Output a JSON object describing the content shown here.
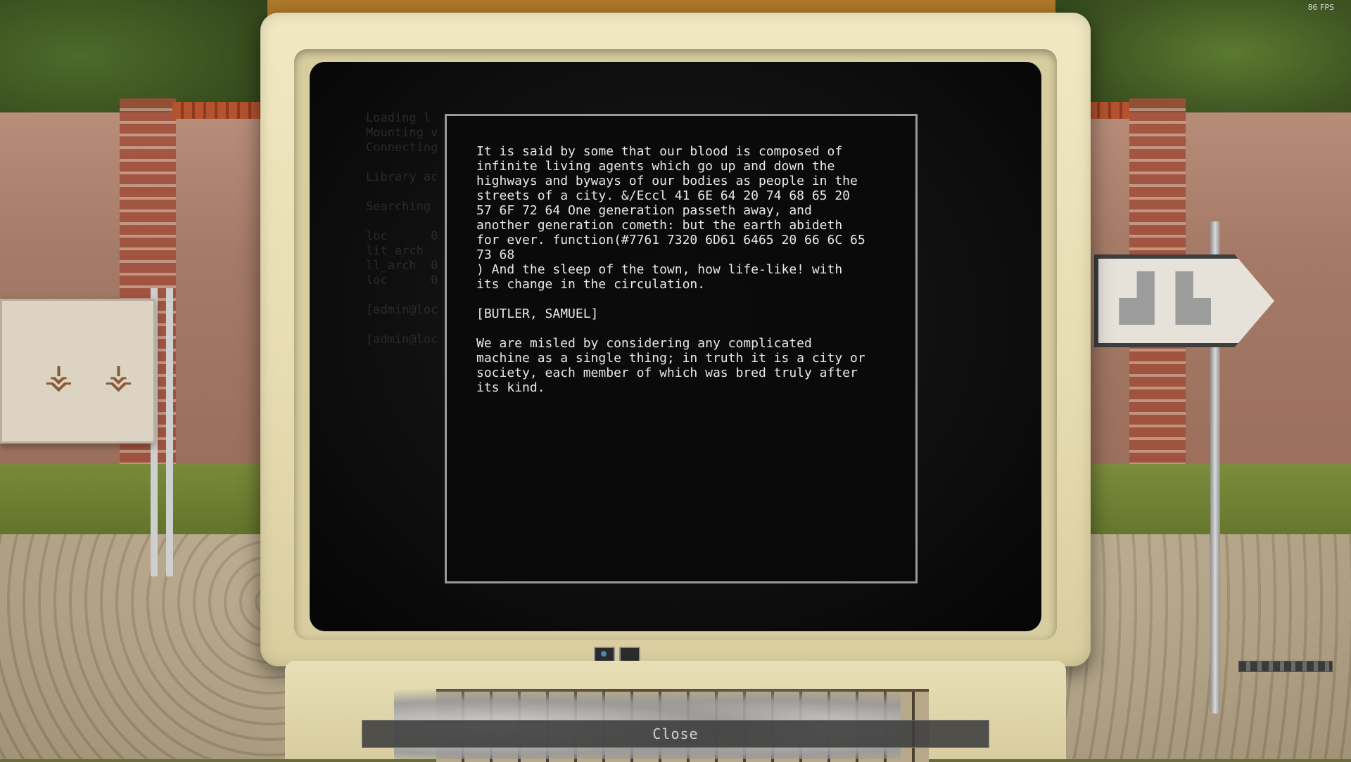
{
  "hud": {
    "fps": "86 FPS"
  },
  "terminal": {
    "background_lines": [
      "Loading l",
      "Mounting v",
      "Connecting",
      "",
      "Library ac",
      "",
      "Searching",
      "",
      "loc      0",
      "lit_arch  ",
      "ll_arch  0",
      "loc      0",
      "",
      "[admin@loc",
      "",
      "[admin@loc"
    ],
    "dialog_text": "It is said by some that our blood is composed of\ninfinite living agents which go up and down the\nhighways and byways of our bodies as people in the\nstreets of a city. &/Eccl 41 6E 64 20 74 68 65 20\n57 6F 72 64 One generation passeth away, and\nanother generation cometh: but the earth abideth\nfor ever. function(#7761 7320 6D61 6465 20 66 6C 65\n73 68\n) And the sleep of the town, how life-like! with\nits change in the circulation.\n\n[BUTLER, SAMUEL]\n\nWe are misled by considering any complicated\nmachine as a single thing; in truth it is a city or\nsociety, each member of which was bred truly after\nits kind."
  },
  "close_button": {
    "label": "Close"
  },
  "colors": {
    "text": "#e8e8e8",
    "frame": "#9a9a9a",
    "monitor": "#efe6c0"
  }
}
